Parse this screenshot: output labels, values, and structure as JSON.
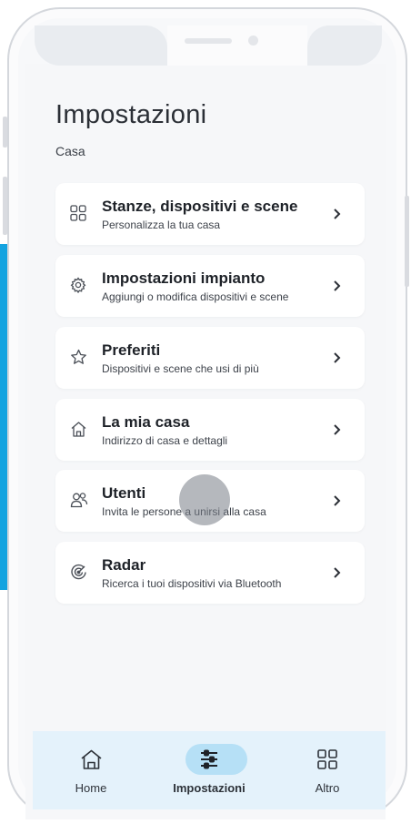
{
  "header": {
    "title": "Impostazioni",
    "subtitle": "Casa"
  },
  "menu": [
    {
      "title": "Stanze, dispositivi e scene",
      "subtitle": "Personalizza la tua casa",
      "icon": "grid-icon"
    },
    {
      "title": "Impostazioni impianto",
      "subtitle": "Aggiungi o modifica dispositivi e scene",
      "icon": "gear-icon"
    },
    {
      "title": "Preferiti",
      "subtitle": "Dispositivi e scene che usi di più",
      "icon": "star-icon"
    },
    {
      "title": "La mia casa",
      "subtitle": "Indirizzo di casa e dettagli",
      "icon": "house-icon"
    },
    {
      "title": "Utenti",
      "subtitle": "Invita le persone a unirsi alla casa",
      "icon": "users-icon"
    },
    {
      "title": "Radar",
      "subtitle": "Ricerca i tuoi dispositivi via Bluetooth",
      "icon": "radar-icon"
    }
  ],
  "nav": [
    {
      "label": "Home",
      "icon": "home-icon",
      "active": false
    },
    {
      "label": "Impostazioni",
      "icon": "sliders-icon",
      "active": true
    },
    {
      "label": "Altro",
      "icon": "grid-icon",
      "active": false
    }
  ],
  "colors": {
    "accent": "#14a3e0",
    "nav_bg": "#e4f2fb",
    "pill": "#b6e0f6"
  }
}
